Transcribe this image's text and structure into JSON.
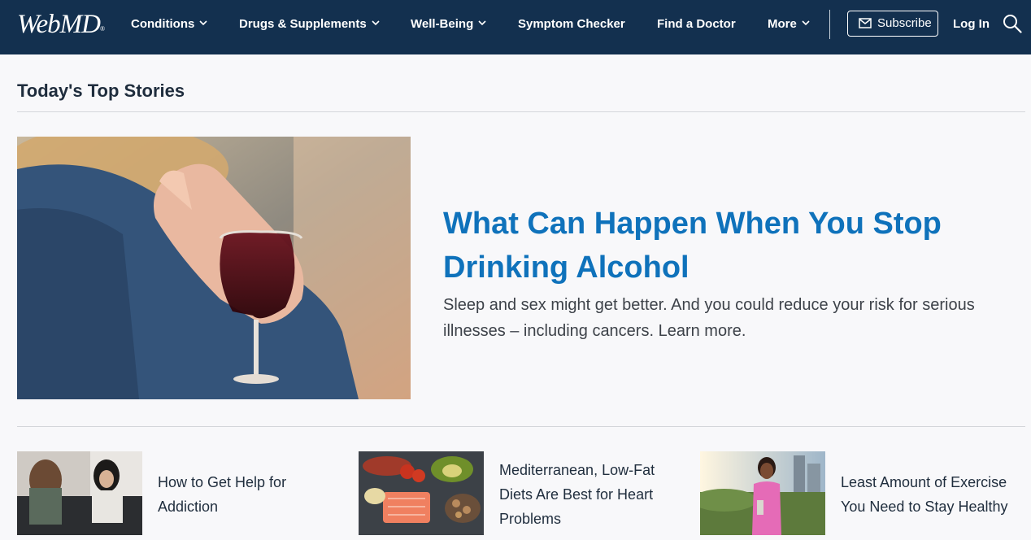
{
  "brand": {
    "logo_text": "WebMD"
  },
  "nav": {
    "items": [
      {
        "label": "Conditions",
        "dropdown": true
      },
      {
        "label": "Drugs & Supplements",
        "dropdown": true
      },
      {
        "label": "Well-Being",
        "dropdown": true
      },
      {
        "label": "Symptom Checker",
        "dropdown": false
      },
      {
        "label": "Find a Doctor",
        "dropdown": false
      },
      {
        "label": "More",
        "dropdown": true
      }
    ],
    "subscribe_label": "Subscribe",
    "login_label": "Log In"
  },
  "colors": {
    "nav_bg": "#13304f",
    "link_blue": "#0f72bb",
    "text_dark": "#1f2d3d"
  },
  "section": {
    "title": "Today's Top Stories"
  },
  "hero": {
    "title": "What Can Happen When You Stop Drinking Alcohol",
    "description": "Sleep and sex might get better. And you could reduce your risk for serious illnesses – including cancers. Learn more."
  },
  "stories": [
    {
      "title": "How to Get Help for Addiction"
    },
    {
      "title": "Mediterranean, Low-Fat Diets Are Best for Heart Problems"
    },
    {
      "title": "Least Amount of Exercise You Need to Stay Healthy"
    }
  ]
}
